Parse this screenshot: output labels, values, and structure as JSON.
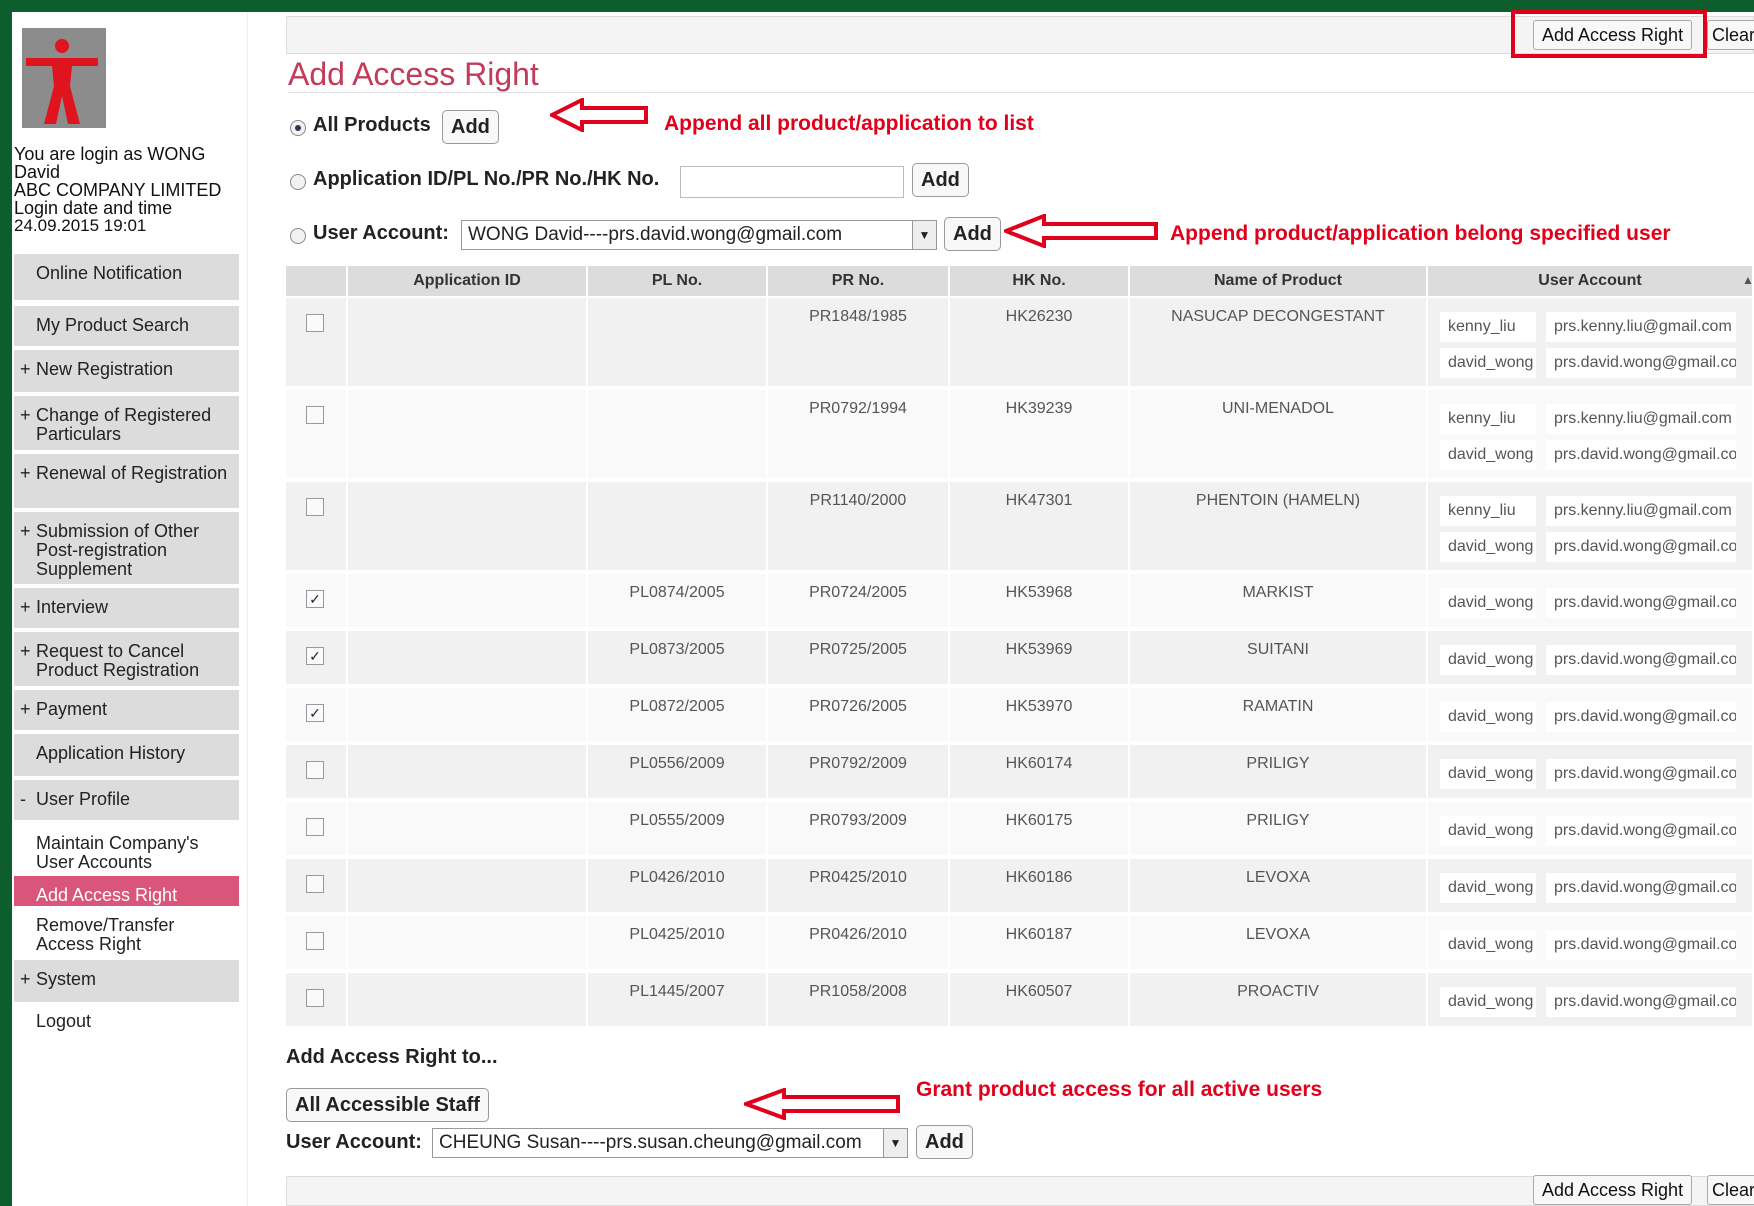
{
  "sidebar": {
    "login": {
      "line1": "You are login as WONG",
      "line2": "David",
      "company": "ABC COMPANY LIMITED",
      "date_label": "Login date and time",
      "date_value": "24.09.2015 19:01"
    },
    "items": [
      {
        "prefix": "",
        "label": "Online Notification"
      },
      {
        "prefix": "",
        "label": "My Product Search"
      },
      {
        "prefix": "+",
        "label": "New Registration"
      },
      {
        "prefix": "+",
        "label": "Change of Registered Particulars"
      },
      {
        "prefix": "+",
        "label": "Renewal of Registration"
      },
      {
        "prefix": "+",
        "label": "Submission of Other Post-registration Supplement"
      },
      {
        "prefix": "+",
        "label": "Interview"
      },
      {
        "prefix": "+",
        "label": "Request to Cancel Product Registration"
      },
      {
        "prefix": "+",
        "label": "Payment"
      },
      {
        "prefix": "",
        "label": "Application History"
      },
      {
        "prefix": "-",
        "label": "User Profile"
      },
      {
        "prefix": "",
        "label": "Maintain Company's User Accounts"
      },
      {
        "prefix": "",
        "label": "Add Access Right"
      },
      {
        "prefix": "",
        "label": "Remove/Transfer Access Right"
      },
      {
        "prefix": "+",
        "label": "System"
      },
      {
        "prefix": "",
        "label": "Logout"
      }
    ]
  },
  "toolbar": {
    "add_access_right": "Add Access Right",
    "clear": "Clear"
  },
  "page": {
    "title": "Add Access Right"
  },
  "options": {
    "all_products": "All Products",
    "app_id": "Application ID/PL No./PR No./HK No.",
    "user_account": "User Account:",
    "user_account_value": "WONG David----prs.david.wong@gmail.com",
    "add": "Add"
  },
  "annotations": {
    "all": "Append all product/application to list",
    "user": "Append product/application belong specified user",
    "grant": "Grant product access for all active users"
  },
  "table": {
    "headers": [
      "Application ID",
      "PL No.",
      "PR No.",
      "HK No.",
      "Name of Product",
      "User Account"
    ],
    "rows": [
      {
        "app": "",
        "pl": "",
        "pr": "PR1848/1985",
        "hk": "HK26230",
        "name": "NASUCAP DECONGESTANT",
        "checked": false,
        "users": [
          {
            "u": "kenny_liu",
            "e": "prs.kenny.liu@gmail.com"
          },
          {
            "u": "david_wong",
            "e": "prs.david.wong@gmail.com"
          }
        ]
      },
      {
        "app": "",
        "pl": "",
        "pr": "PR0792/1994",
        "hk": "HK39239",
        "name": "UNI-MENADOL",
        "checked": false,
        "users": [
          {
            "u": "kenny_liu",
            "e": "prs.kenny.liu@gmail.com"
          },
          {
            "u": "david_wong",
            "e": "prs.david.wong@gmail.com"
          }
        ]
      },
      {
        "app": "",
        "pl": "",
        "pr": "PR1140/2000",
        "hk": "HK47301",
        "name": "PHENTOIN (HAMELN)",
        "checked": false,
        "users": [
          {
            "u": "kenny_liu",
            "e": "prs.kenny.liu@gmail.com"
          },
          {
            "u": "david_wong",
            "e": "prs.david.wong@gmail.com"
          }
        ]
      },
      {
        "app": "",
        "pl": "PL0874/2005",
        "pr": "PR0724/2005",
        "hk": "HK53968",
        "name": "MARKIST",
        "checked": true,
        "users": [
          {
            "u": "david_wong",
            "e": "prs.david.wong@gmail.com"
          }
        ]
      },
      {
        "app": "",
        "pl": "PL0873/2005",
        "pr": "PR0725/2005",
        "hk": "HK53969",
        "name": "SUITANI",
        "checked": true,
        "users": [
          {
            "u": "david_wong",
            "e": "prs.david.wong@gmail.com"
          }
        ]
      },
      {
        "app": "",
        "pl": "PL0872/2005",
        "pr": "PR0726/2005",
        "hk": "HK53970",
        "name": "RAMATIN",
        "checked": true,
        "users": [
          {
            "u": "david_wong",
            "e": "prs.david.wong@gmail.com"
          }
        ]
      },
      {
        "app": "",
        "pl": "PL0556/2009",
        "pr": "PR0792/2009",
        "hk": "HK60174",
        "name": "PRILIGY",
        "checked": false,
        "users": [
          {
            "u": "david_wong",
            "e": "prs.david.wong@gmail.com"
          }
        ]
      },
      {
        "app": "",
        "pl": "PL0555/2009",
        "pr": "PR0793/2009",
        "hk": "HK60175",
        "name": "PRILIGY",
        "checked": false,
        "users": [
          {
            "u": "david_wong",
            "e": "prs.david.wong@gmail.com"
          }
        ]
      },
      {
        "app": "",
        "pl": "PL0426/2010",
        "pr": "PR0425/2010",
        "hk": "HK60186",
        "name": "LEVOXA",
        "checked": false,
        "users": [
          {
            "u": "david_wong",
            "e": "prs.david.wong@gmail.com"
          }
        ]
      },
      {
        "app": "",
        "pl": "PL0425/2010",
        "pr": "PR0426/2010",
        "hk": "HK60187",
        "name": "LEVOXA",
        "checked": false,
        "users": [
          {
            "u": "david_wong",
            "e": "prs.david.wong@gmail.com"
          }
        ]
      },
      {
        "app": "",
        "pl": "PL1445/2007",
        "pr": "PR1058/2008",
        "hk": "HK60507",
        "name": "PROACTIV",
        "checked": false,
        "users": [
          {
            "u": "david_wong",
            "e": "prs.david.wong@gmail.com"
          }
        ]
      }
    ]
  },
  "bottom": {
    "section_title": "Add Access Right to...",
    "all_staff": "All Accessible Staff",
    "user_account": "User Account:",
    "user_account_value": "CHEUNG Susan----prs.susan.cheung@gmail.com",
    "add": "Add"
  },
  "colors": {
    "accent": "#c23b5a",
    "active_menu": "#d9557a",
    "annotation": "#e0001b",
    "frame": "#0d5e2c"
  }
}
